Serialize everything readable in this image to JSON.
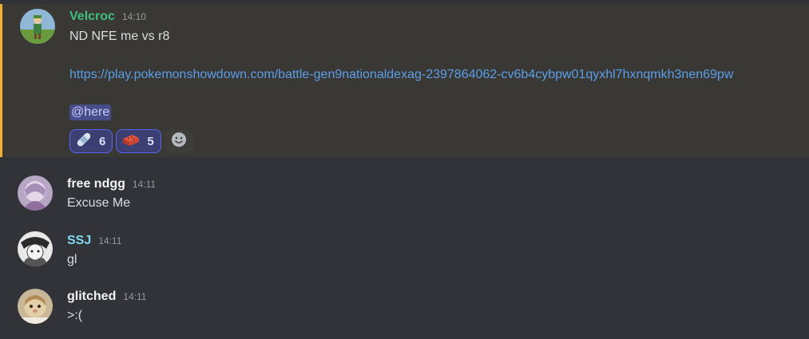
{
  "messages": [
    {
      "author": "Velcroc",
      "author_color": "#3fbf7f",
      "time": "14:10",
      "line1": "ND NFE me vs r8",
      "link": "https://play.pokemonshowdown.com/battle-gen9nationaldexag-2397864062-cv6b4cybpw01qyxhl7hxnqmkh3nen69pw",
      "mention": "@here",
      "reactions": [
        {
          "emoji": "bandage-icon",
          "count": "6"
        },
        {
          "emoji": "brick-icon",
          "count": "5"
        }
      ],
      "add_reaction_icon": "smiley-icon"
    },
    {
      "author": "free ndgg",
      "author_color": "#f2f3f5",
      "time": "14:11",
      "text": "Excuse Me"
    },
    {
      "author": "SSJ",
      "author_color": "#7fd8ef",
      "time": "14:11",
      "text": "gl"
    },
    {
      "author": "glitched",
      "author_color": "#f2f3f5",
      "time": "14:11",
      "text": ">:("
    }
  ],
  "colors": {
    "background": "#313338",
    "highlight_background": "#3a3835",
    "highlight_border": "#f0b232",
    "link": "#5b9ee8"
  }
}
